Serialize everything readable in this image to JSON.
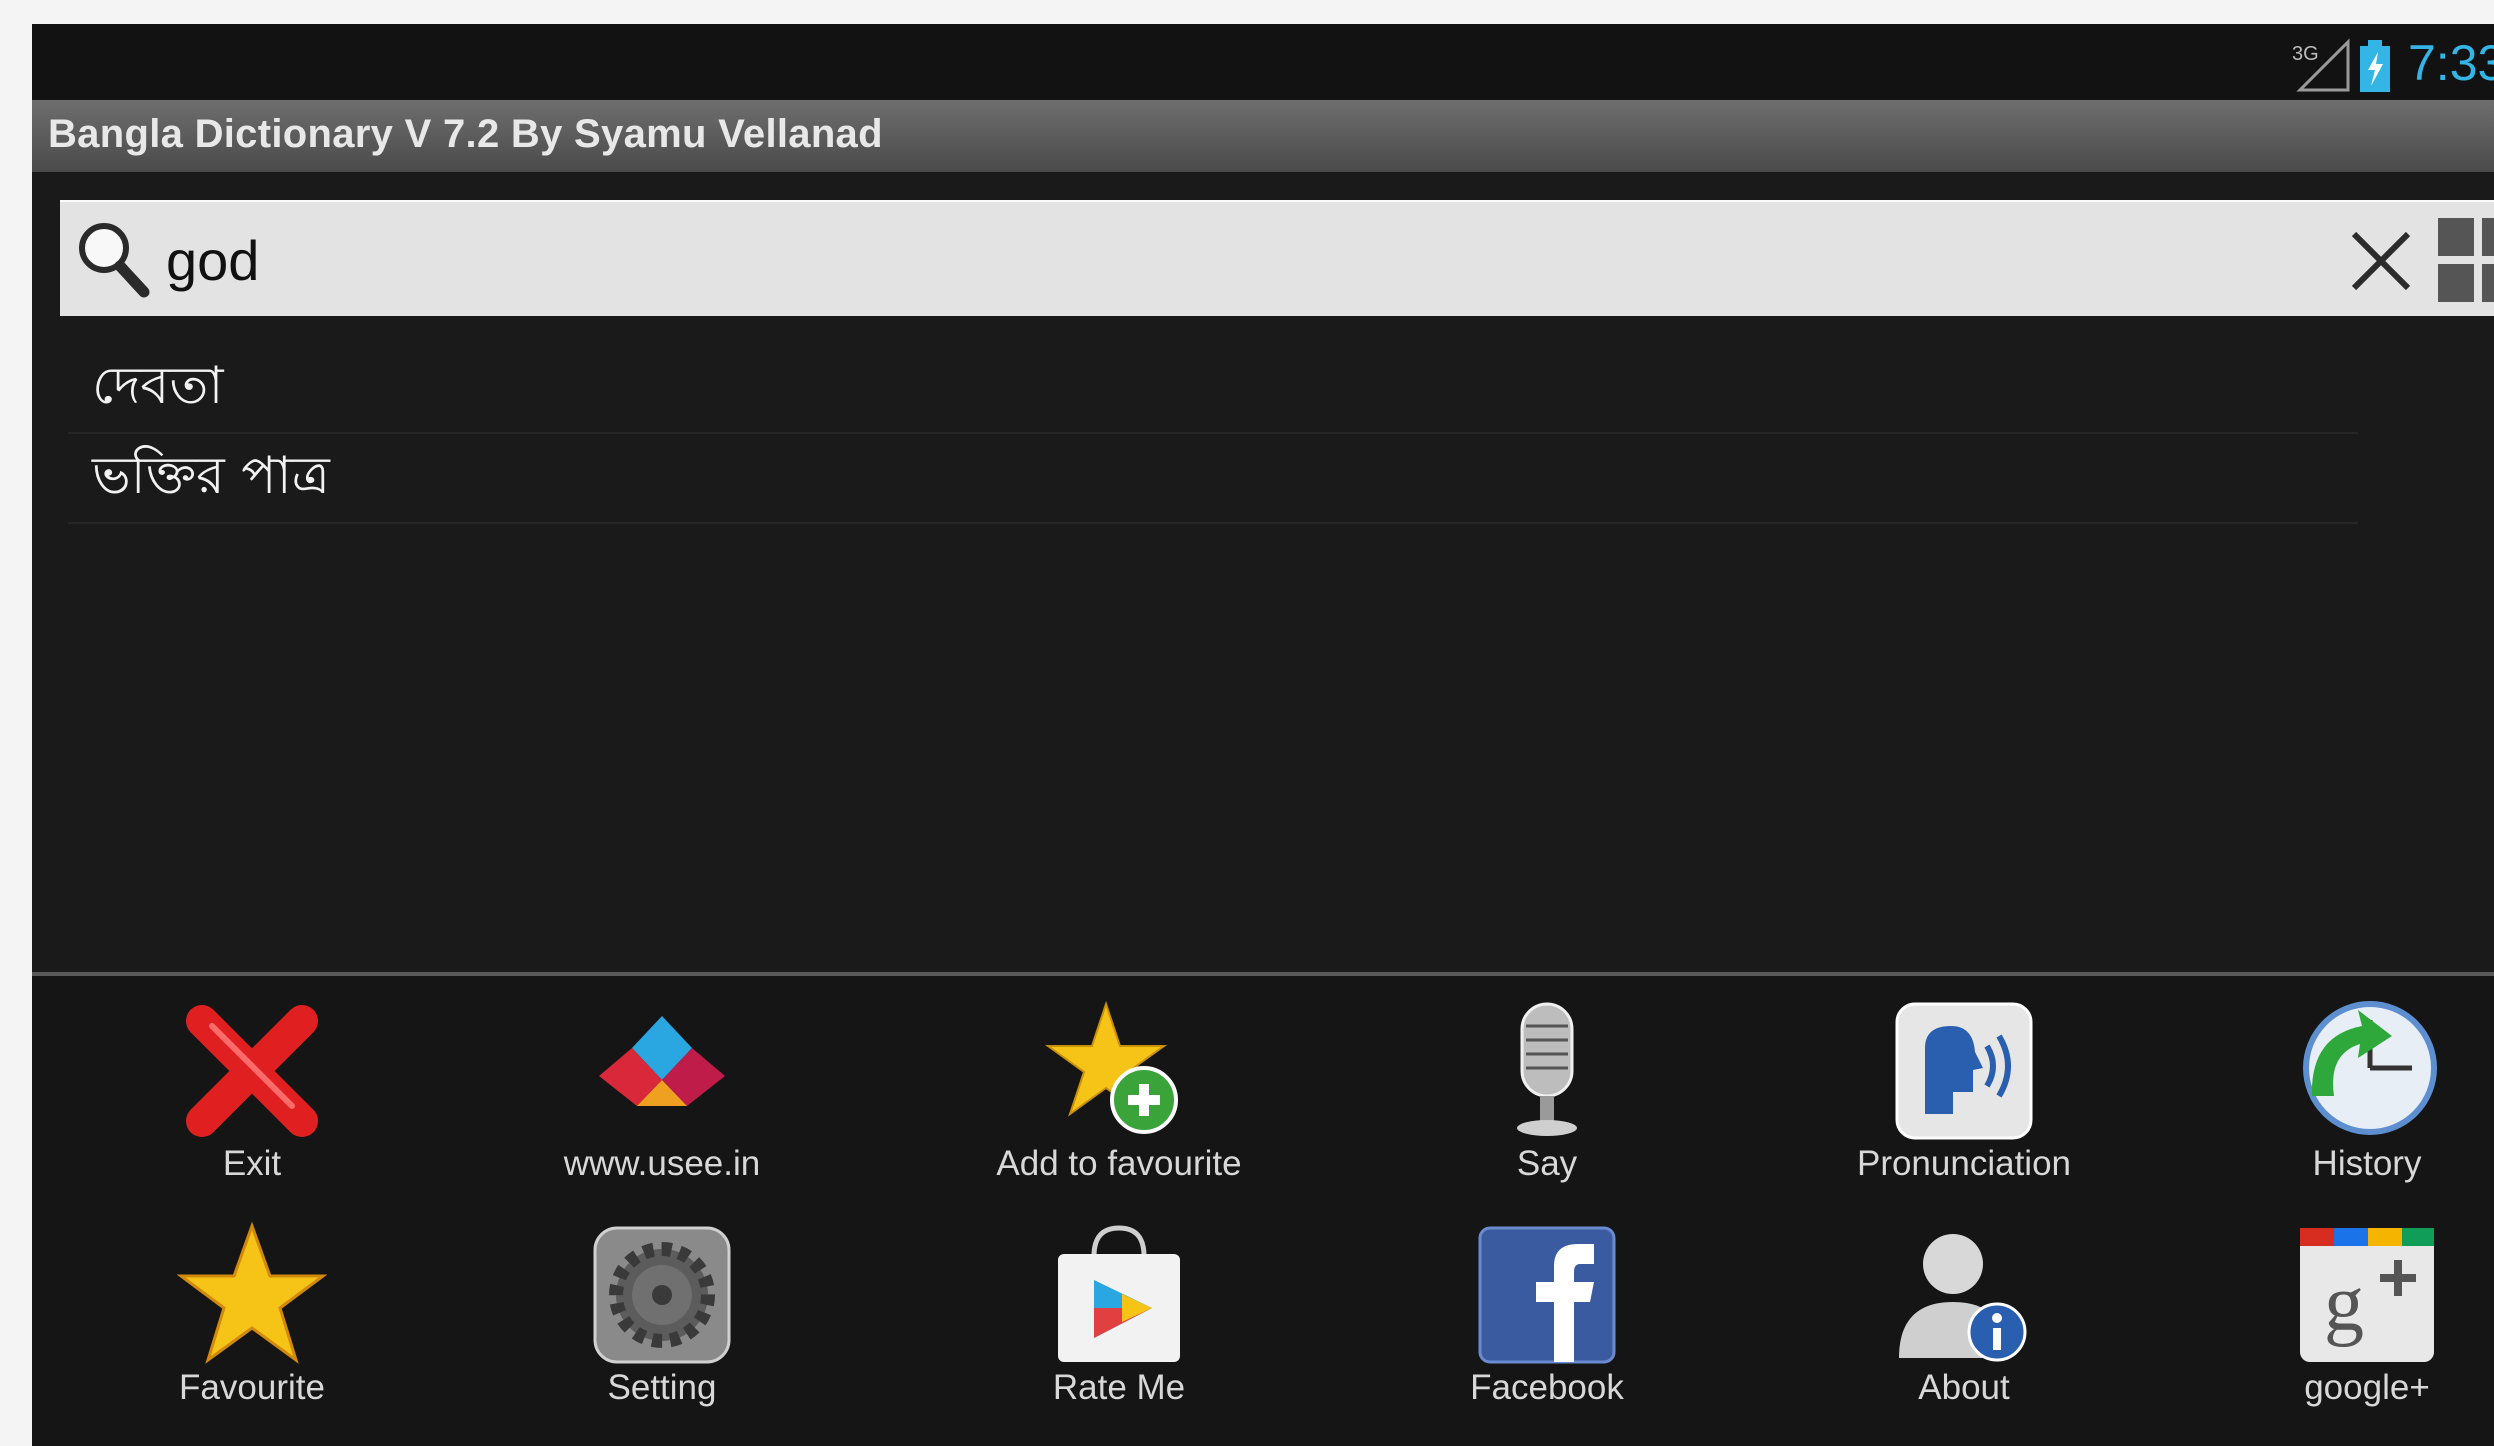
{
  "status_bar": {
    "network": "3G",
    "time": "7:33"
  },
  "app": {
    "title": "Bangla Dictionary V 7.2 By Syamu Vellanad"
  },
  "search": {
    "query": "god"
  },
  "results": [
    "দেবতা",
    "ভক্তির পাত্র"
  ],
  "menu": {
    "items": [
      {
        "label": "Exit",
        "icon": "exit-icon"
      },
      {
        "label": "www.usee.in",
        "icon": "usee-logo-icon"
      },
      {
        "label": "Add to favourite",
        "icon": "star-add-icon"
      },
      {
        "label": "Say",
        "icon": "microphone-icon"
      },
      {
        "label": "Pronunciation",
        "icon": "speaking-head-icon"
      },
      {
        "label": "History",
        "icon": "clock-arrow-icon"
      },
      {
        "label": "Favourite",
        "icon": "star-icon"
      },
      {
        "label": "Setting",
        "icon": "gear-icon"
      },
      {
        "label": "Rate Me",
        "icon": "play-store-bag-icon"
      },
      {
        "label": "Facebook",
        "icon": "facebook-icon"
      },
      {
        "label": "About",
        "icon": "user-info-icon"
      },
      {
        "label": "google+",
        "icon": "google-plus-icon"
      }
    ]
  },
  "colors": {
    "accent": "#33b5e5",
    "background": "#1a1a1a",
    "title_bar": "#5a5a5a",
    "search_bar": "#e3e3e3"
  }
}
